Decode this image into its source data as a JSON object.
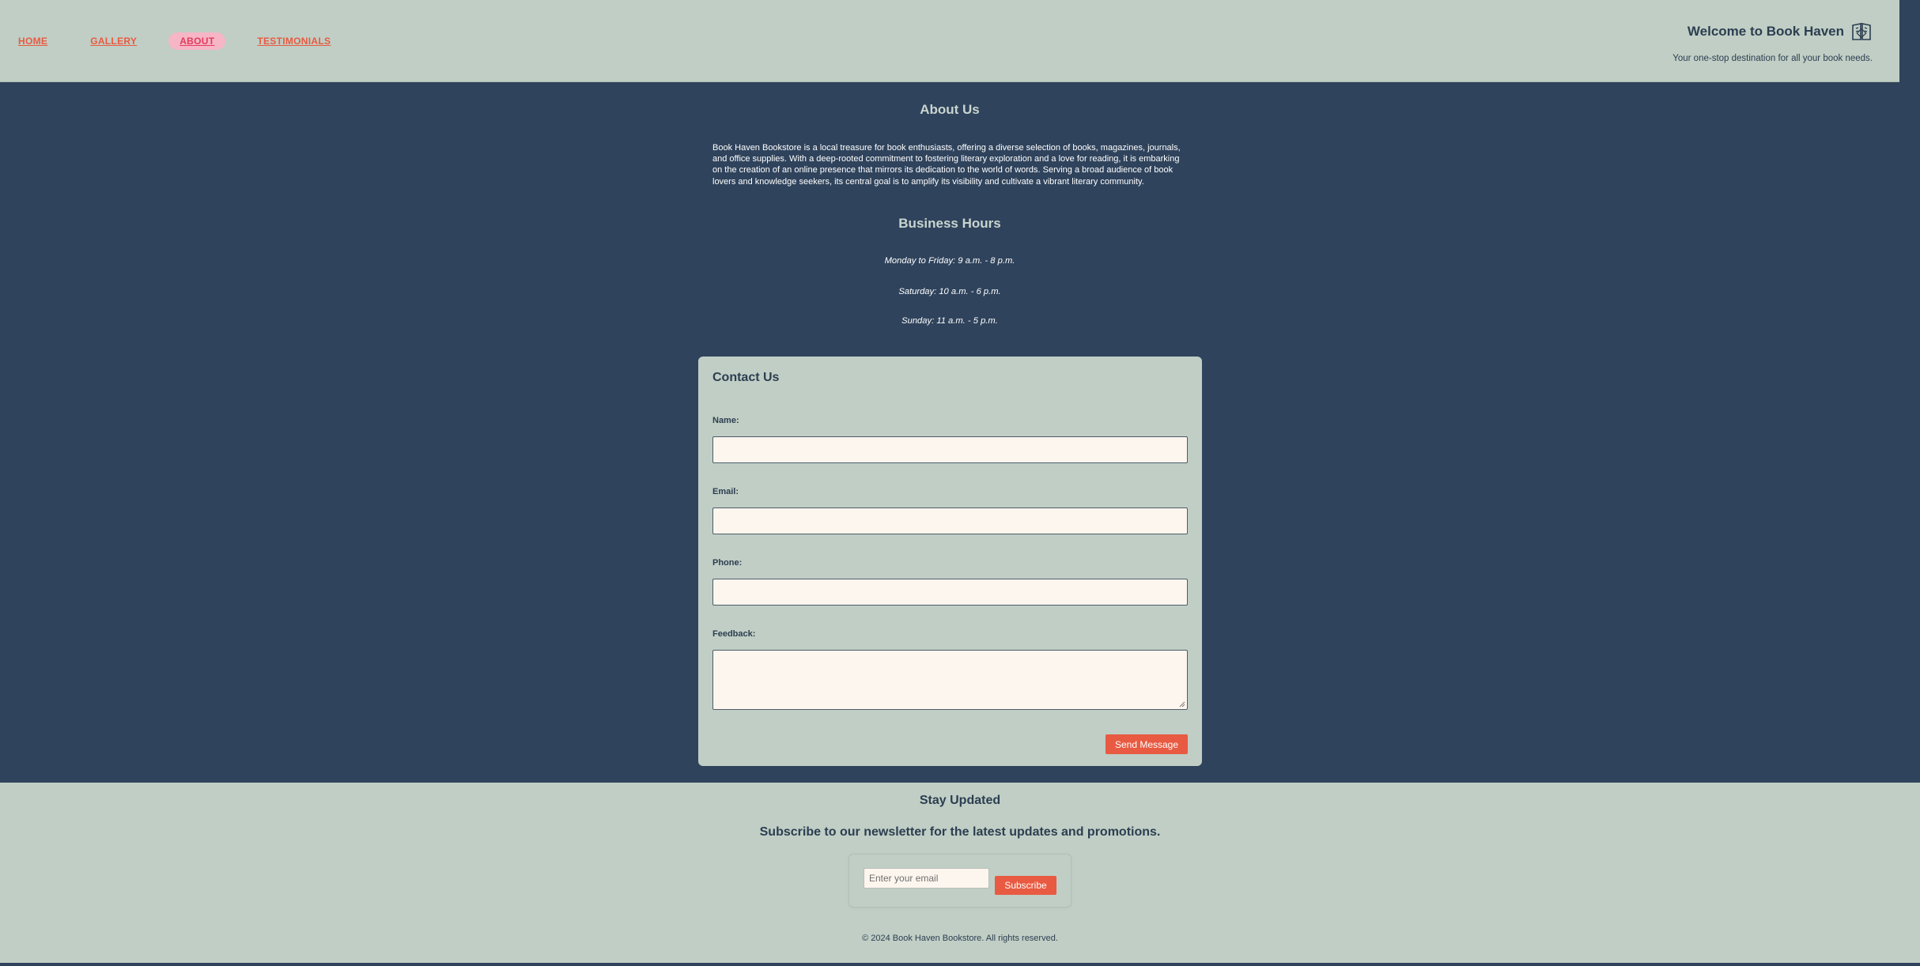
{
  "nav": {
    "items": [
      {
        "label": "HOME",
        "active": false
      },
      {
        "label": "GALLERY",
        "active": false
      },
      {
        "label": "ABOUT",
        "active": true
      },
      {
        "label": "TESTIMONIALS",
        "active": false
      }
    ]
  },
  "brand": {
    "title": "Welcome to Book Haven",
    "tagline": "Your one-stop destination for all your book needs.",
    "logo_icon": "book-icon"
  },
  "about": {
    "title": "About Us",
    "text": "Book Haven Bookstore is a local treasure for book enthusiasts, offering a diverse selection of books, magazines, journals, and office supplies. With a deep-rooted commitment to fostering literary exploration and a love for reading, it is embarking on the creation of an online presence that mirrors its dedication to the world of words. Serving a broad audience of book lovers and knowledge seekers, its central goal is to amplify its visibility and cultivate a vibrant literary community."
  },
  "hours": {
    "title": "Business Hours",
    "lines": [
      "Monday to Friday: 9 a.m. - 8 p.m.",
      "Saturday: 10 a.m. - 6 p.m.",
      "Sunday: 11 a.m. - 5 p.m."
    ]
  },
  "contact": {
    "title": "Contact Us",
    "fields": [
      {
        "label": "Name:",
        "value": ""
      },
      {
        "label": "Email:",
        "value": ""
      },
      {
        "label": "Phone:",
        "value": ""
      },
      {
        "label": "Feedback:",
        "value": ""
      }
    ],
    "send_label": "Send Message"
  },
  "footer": {
    "title": "Stay Updated",
    "subtitle": "Subscribe to our newsletter for the latest updates and promotions.",
    "email_placeholder": "Enter your email",
    "subscribe_label": "Subscribe",
    "copyright": "© 2024 Book Haven Bookstore. All rights reserved."
  },
  "colors": {
    "header_bg": "#c0cec5",
    "main_bg": "#2f435c",
    "accent": "#e85a41",
    "active_nav_bg": "#f6b6c6",
    "input_bg": "#fdf6ee",
    "text_dark": "#2c3e50"
  }
}
